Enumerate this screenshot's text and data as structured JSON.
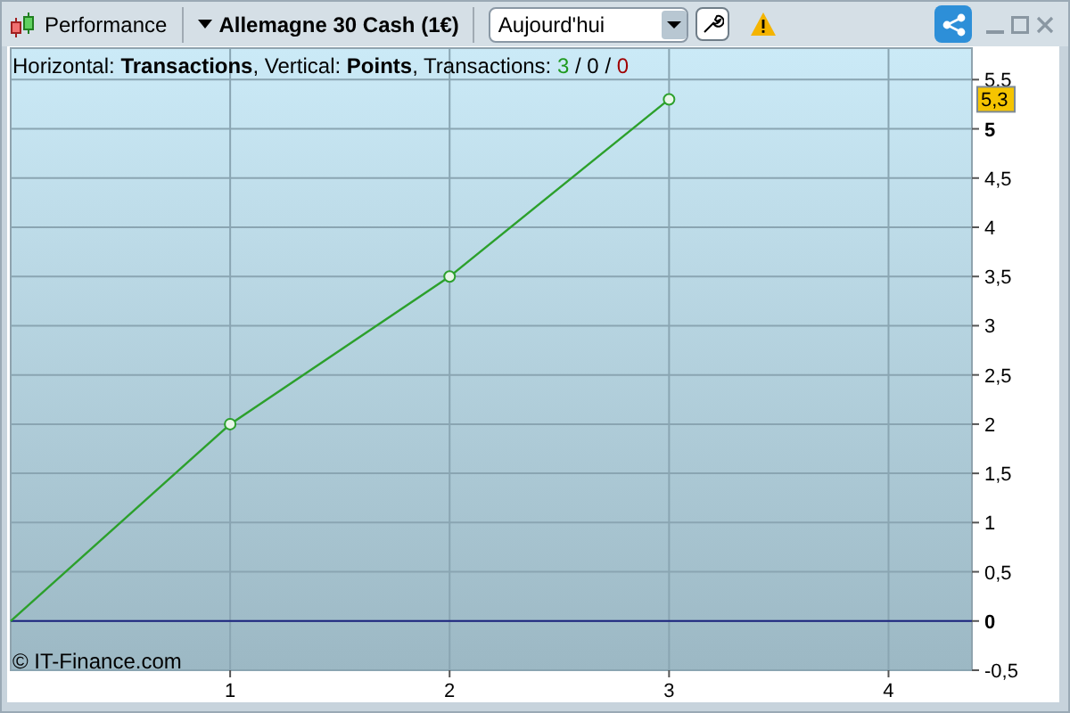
{
  "toolbar": {
    "app_label": "Performance",
    "instrument": "Allemagne 30 Cash (1€)",
    "period_select": {
      "value": "Aujourd'hui"
    }
  },
  "chart": {
    "legend": [
      {
        "text": "Horizontal: **Transactions**, Vertical: **Points**, Transactions: "
      },
      {
        "text": "3",
        "color": "#1f9a1f"
      },
      {
        "text": " / "
      },
      {
        "text": "0",
        "color": "#000000"
      },
      {
        "text": " / "
      },
      {
        "text": "0",
        "color": "#a00000"
      }
    ],
    "credit": "© IT-Finance.com",
    "chart_data": {
      "type": "line",
      "x": [
        0,
        1,
        2,
        3
      ],
      "series": [
        {
          "color": "#2ca02c",
          "values": [
            0,
            2,
            3.5,
            5.3
          ]
        }
      ],
      "grid": true,
      "ref_lines": [
        {
          "axis": "y",
          "value": 0,
          "color": "#1a237e"
        }
      ],
      "xlim": [
        0,
        4.38
      ],
      "ylim": [
        -0.5,
        5.82
      ],
      "xticks": [
        1,
        2,
        3,
        4
      ],
      "yticks": [
        {
          "value": -0.5,
          "label": "-0,5"
        },
        {
          "value": 0,
          "label": "0"
        },
        {
          "value": 0.5,
          "label": "0,5"
        },
        {
          "value": 1,
          "label": "1"
        },
        {
          "value": 1.5,
          "label": "1,5"
        },
        {
          "value": 2,
          "label": "2"
        },
        {
          "value": 2.5,
          "label": "2,5"
        },
        {
          "value": 3,
          "label": "3"
        },
        {
          "value": 3.5,
          "label": "3,5"
        },
        {
          "value": 4,
          "label": "4"
        },
        {
          "value": 4.5,
          "label": "4,5"
        },
        {
          "value": 5,
          "label": "5"
        },
        {
          "value": 5.5,
          "label": "5,5"
        }
      ],
      "annotations": [
        {
          "text": "5,3"
        }
      ]
    }
  }
}
